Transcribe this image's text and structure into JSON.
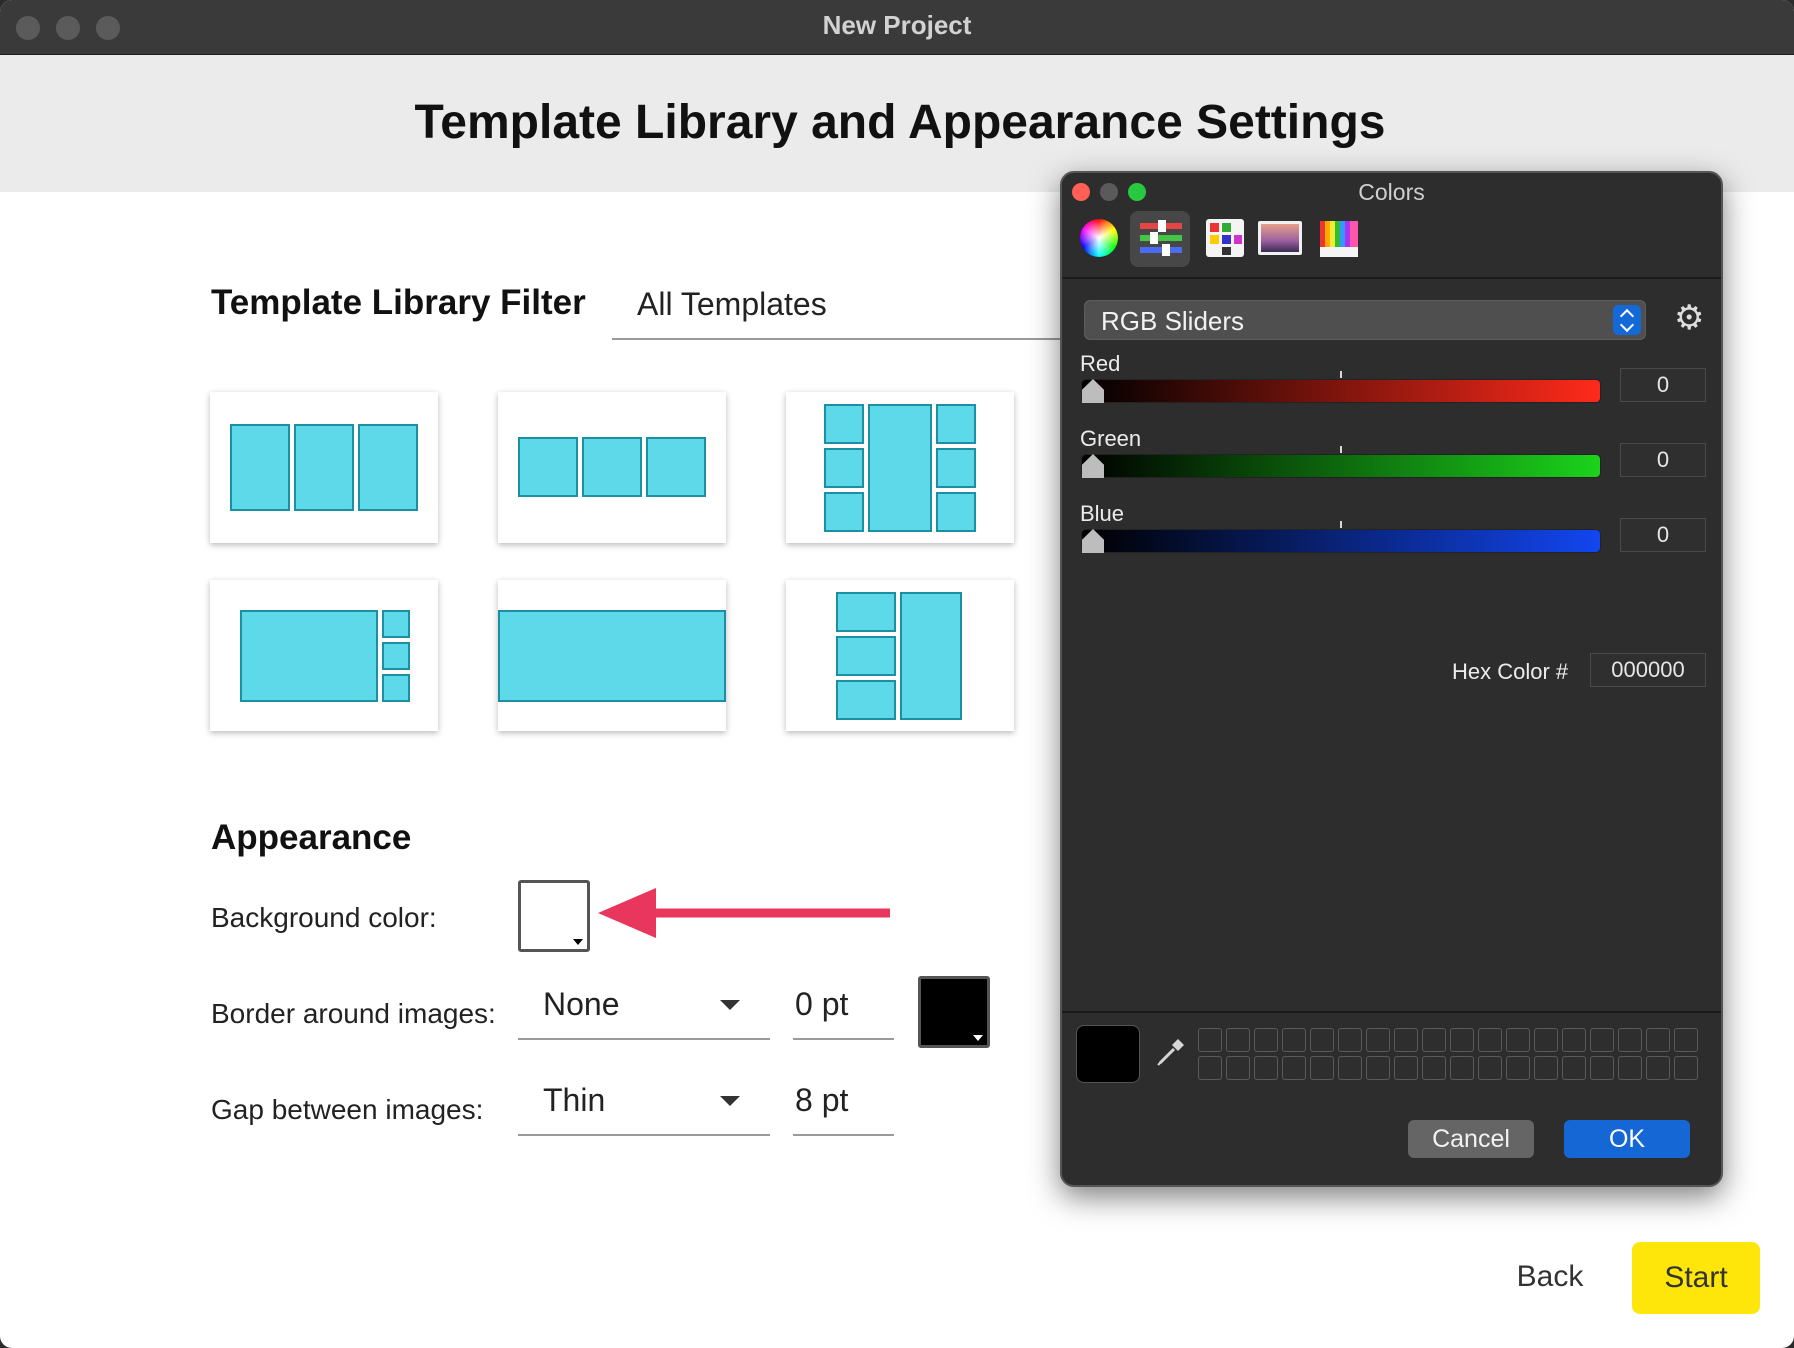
{
  "window": {
    "title": "New Project"
  },
  "page": {
    "title": "Template Library and Appearance Settings"
  },
  "filter": {
    "label": "Template Library Filter",
    "value": "All Templates"
  },
  "templates": [
    {
      "name": "three-column"
    },
    {
      "name": "three-column-short"
    },
    {
      "name": "tall-center-six-sides"
    },
    {
      "name": "large-left-three-right"
    },
    {
      "name": "single-wide"
    },
    {
      "name": "three-left-tall-right"
    }
  ],
  "appearance": {
    "title": "Appearance",
    "background_label": "Background color:",
    "background_color": "#ffffff",
    "border_label": "Border around images:",
    "border_style": "None",
    "border_size": "0 pt",
    "border_color": "#000000",
    "gap_label": "Gap between images:",
    "gap_style": "Thin",
    "gap_size": "8 pt"
  },
  "annotation": {
    "arrow_color": "#e8365d"
  },
  "actions": {
    "back": "Back",
    "start": "Start",
    "start_color": "#ffe60a"
  },
  "colors_panel": {
    "title": "Colors",
    "tools": [
      "color-wheel-icon",
      "sliders-icon",
      "palettes-icon",
      "image-palettes-icon",
      "pencils-icon"
    ],
    "mode": "RGB Sliders",
    "sliders": [
      {
        "label": "Red",
        "value": "0",
        "color": "#ff2a1a"
      },
      {
        "label": "Green",
        "value": "0",
        "color": "#1bd31b"
      },
      {
        "label": "Blue",
        "value": "0",
        "color": "#1246f0"
      }
    ],
    "hex_label": "Hex Color #",
    "hex_value": "000000",
    "current_color": "#000000",
    "cancel": "Cancel",
    "ok": "OK"
  }
}
